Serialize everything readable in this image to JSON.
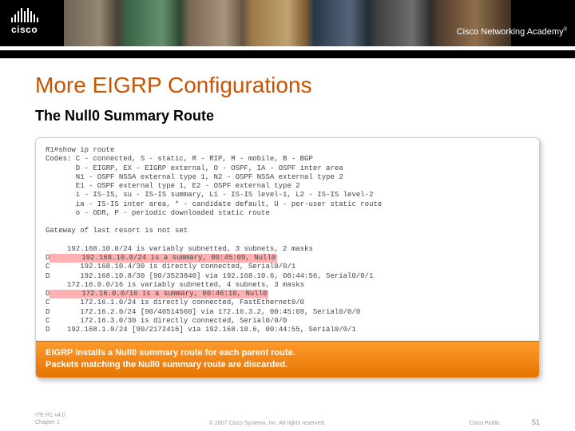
{
  "header": {
    "brand": "cisco",
    "academy": "Cisco Networking Academy"
  },
  "slide": {
    "title": "More EIGRP Configurations",
    "subtitle": "The Null0 Summary Route"
  },
  "terminal": {
    "prompt": "R1#show ip route",
    "codes": [
      "Codes: C - connected, S - static, R - RIP, M - mobile, B - BGP",
      "       D - EIGRP, EX - EIGRP external, O - OSPF, IA - OSPF inter area",
      "       N1 - OSPF NSSA external type 1, N2 - OSPF NSSA external type 2",
      "       E1 - OSPF external type 1, E2 - OSPF external type 2",
      "       i - IS-IS, su - IS-IS summary, L1 - IS-IS level-1, L2 - IS-IS level-2",
      "       ia - IS-IS inter area, * - candidate default, U - per-user static route",
      "       o - ODR, P - periodic downloaded static route"
    ],
    "gateway": "Gateway of last resort is not set",
    "r1": "     192.168.10.0/24 is variably subnetted, 3 subnets, 2 masks",
    "r2flag": "D",
    "r2": "       192.168.10.0/24 is a summary, 00:45:09, Null0",
    "r3": "C       192.168.10.4/30 is directly connected, Serial0/0/1",
    "r4": "D       192.168.10.8/30 [90/3523840] via 192.168.10.6, 00:44:56, Serial0/0/1",
    "r5": "     172.16.0.0/16 is variably subnetted, 4 subnets, 3 masks",
    "r6flag": "D",
    "r6": "       172.16.0.0/16 is a summary, 00:46:10, Null0",
    "r7": "C       172.16.1.0/24 is directly connected, FastEthernet0/0",
    "r8": "D       172.16.2.0/24 [90/40514560] via 172.16.3.2, 00:45:09, Serial0/0/0",
    "r9": "C       172.16.3.0/30 is directly connected, Serial0/0/0",
    "r10": "D    192.168.1.0/24 [90/2172416] via 192.168.10.6, 00:44:55, Serial0/0/1"
  },
  "caption": {
    "line1": "EIGRP installs a Null0 summary route for each parent route.",
    "line2": "Packets matching the Null0 summary route are discarded."
  },
  "footer": {
    "left1": "ITE PC v4.0",
    "left2": "Chapter 1",
    "copyright": "© 2007 Cisco Systems, Inc. All rights reserved.",
    "cp": "Cisco Public",
    "page": "51"
  }
}
